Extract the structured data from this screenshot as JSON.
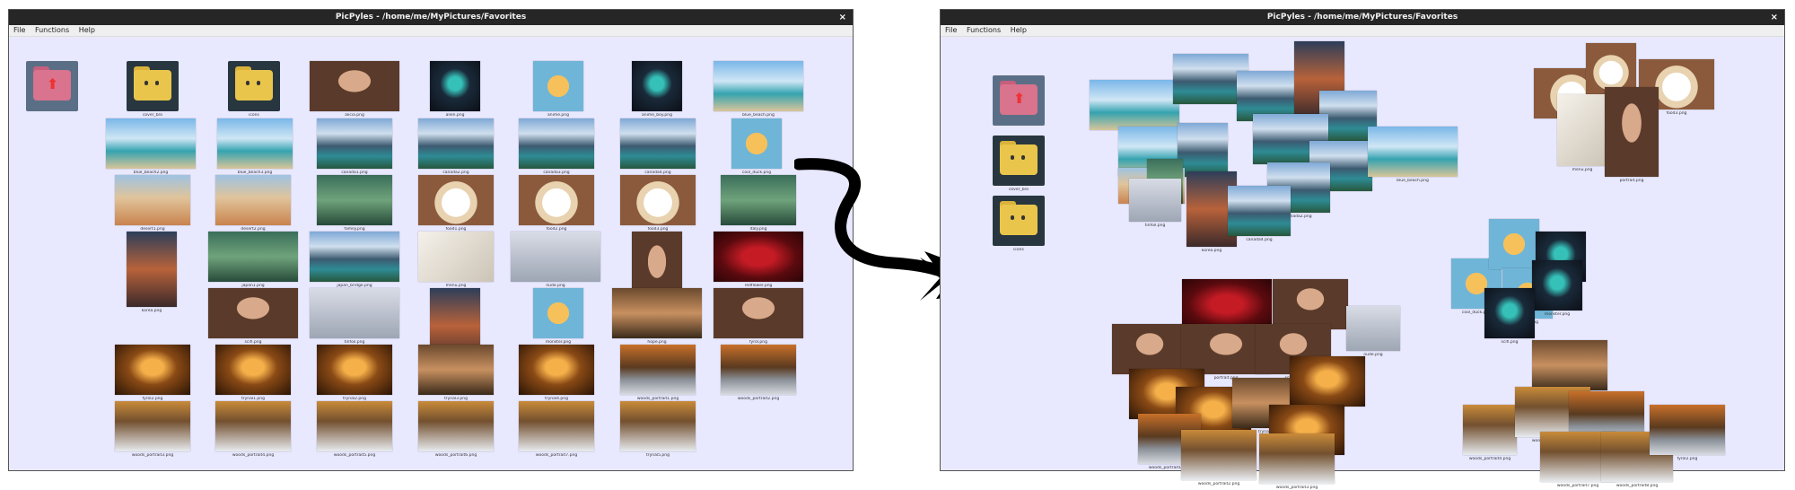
{
  "window_title": "PicPyles - /home/me/MyPictures/Favorites",
  "menu": [
    "File",
    "Functions",
    "Help"
  ],
  "close_glyph": "×",
  "labels": {
    "cover_bro": "cover_bro",
    "icons": "icons",
    "alicia": "alicia.png",
    "alien": "alien.png",
    "anime": "anime.png",
    "anime_boy": "anime_boy.png",
    "blue_beach": "blue_beach.png",
    "blue_beach2": "blue_beach2.png",
    "blue_beach3": "blue_beach3.png",
    "canada1": "canada1.png",
    "canada2": "canada2.png",
    "canada3": "canada3.png",
    "canada4": "canada4.png",
    "cool_duck": "cool_duck.png",
    "desert1": "desert1.png",
    "desert2": "desert2.png",
    "family": "family.png",
    "food1": "food1.png",
    "food2": "food2.png",
    "food3": "food3.png",
    "italy": "italy.png",
    "korea": "korea.png",
    "japan1": "japan1.png",
    "japan_bridge": "japan_bridge.png",
    "menu": "menu.png",
    "nude": "nude.png",
    "portrait": "portrait.png",
    "redflower": "redflower.png",
    "scifi": "scifi.png",
    "tinfoil": "tinfoil.png",
    "vision": "vision.png",
    "monster": "monster.png",
    "hope": "hope.png",
    "fyrol": "fyrol.png",
    "fyrol2": "fyrol2.png",
    "trynal1": "trynal1.png",
    "trynal2": "trynal2.png",
    "trynal3": "trynal3.png",
    "trynal4": "trynal4.png",
    "trynal5": "trynal5.png",
    "woods_portrait1": "woods_portrait1.png",
    "woods_portrait2": "woods_portrait2.png",
    "woods_portrait3": "woods_portrait3.png",
    "woods_portrait4": "woods_portrait4.png",
    "woods_portrait5": "woods_portrait5.png",
    "woods_portrait6": "woods_portrait6.png",
    "woods_portrait7": "woods_portrait7.png",
    "woods_portrait8": "woods_portrait8.png"
  },
  "colors": {
    "canvas_bg": "#e8e8ff",
    "titlebar_bg": "#262626",
    "arrow": "#000000"
  },
  "icons": [
    "folder-up-icon",
    "folder-icon",
    "close-icon"
  ]
}
